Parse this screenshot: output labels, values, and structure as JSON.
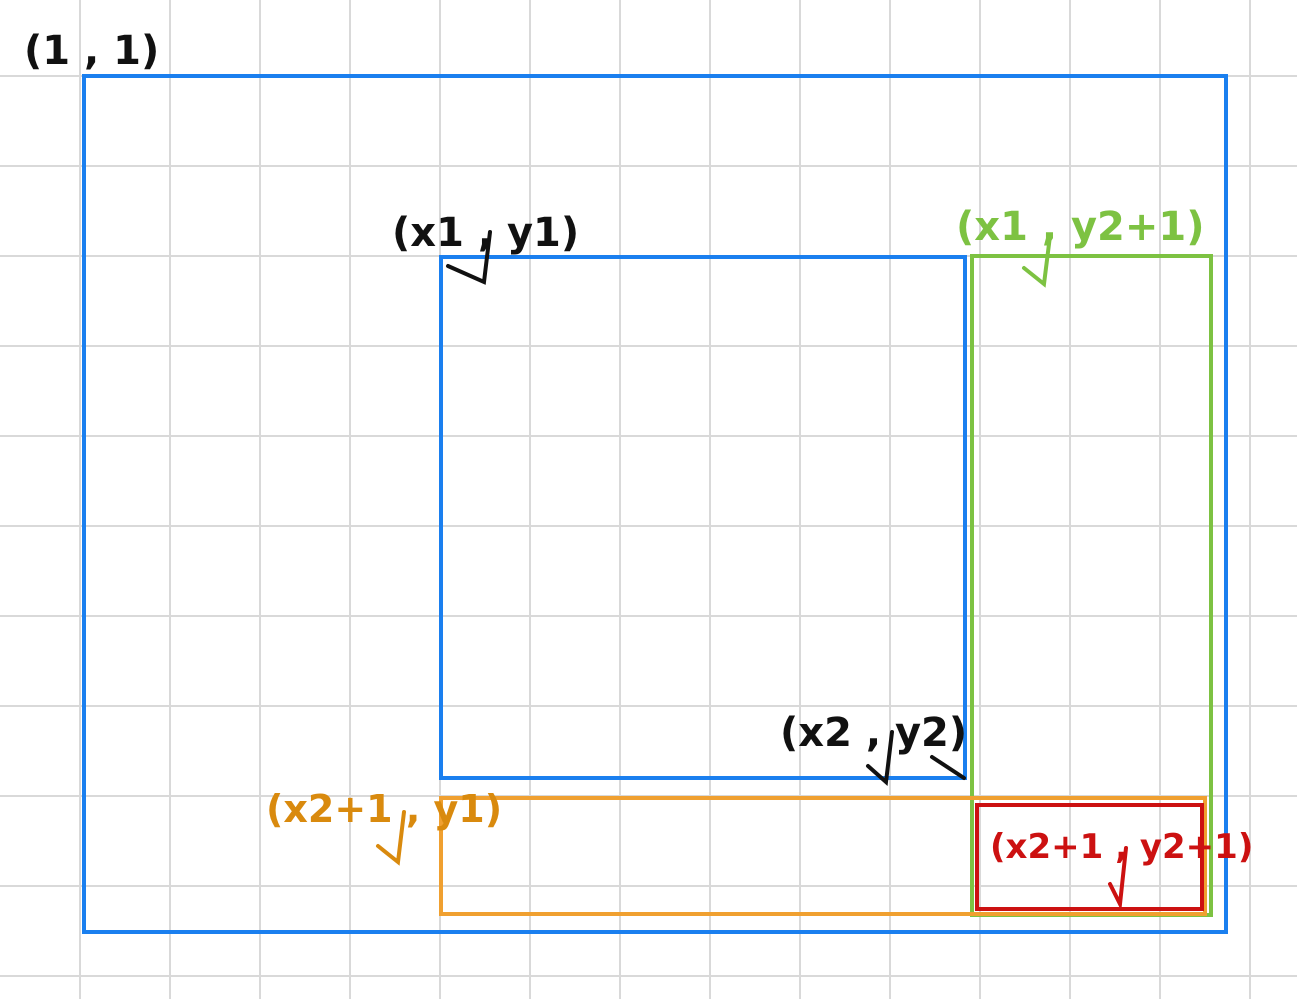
{
  "colors": {
    "grid": "#d9d9d9",
    "blue": "#1a7fef",
    "green": "#7dc242",
    "orange": "#f0a030",
    "orange_text": "#d98a0e",
    "red": "#cc1111",
    "black": "#111111"
  },
  "labels": {
    "origin": "(1 , 1)",
    "top_left": "(x1 , y1)",
    "bottom_right": "(x2 , y2)",
    "right_region": "(x1 , y2+1)",
    "bottom_region": "(x2+1 , y1)",
    "corner_region": "(x2+1 , y2+1)"
  }
}
